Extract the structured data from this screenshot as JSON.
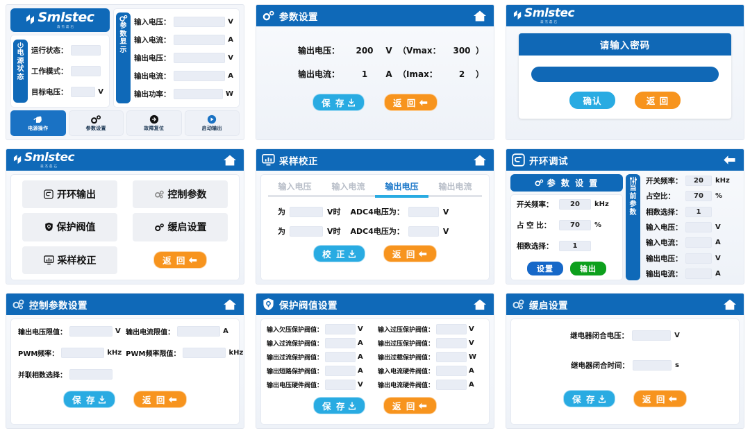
{
  "brand": {
    "name": "Smlstec",
    "sub": "森杰磊石"
  },
  "panel1": {
    "power_tab": "电源状态",
    "power_rows": [
      {
        "label": "运行状态：",
        "value": "",
        "unit": ""
      },
      {
        "label": "工作模式：",
        "value": "",
        "unit": ""
      },
      {
        "label": "目标电压：",
        "value": "",
        "unit": "V"
      }
    ],
    "param_tab": "参数显示",
    "param_rows": [
      {
        "label": "输入电压：",
        "value": "",
        "unit": "V"
      },
      {
        "label": "输入电流：",
        "value": "",
        "unit": "A"
      },
      {
        "label": "输出电压：",
        "value": "",
        "unit": "V"
      },
      {
        "label": "输出电流：",
        "value": "",
        "unit": "A"
      },
      {
        "label": "输出功率：",
        "value": "",
        "unit": "W"
      }
    ],
    "tabs": [
      {
        "label": "电源操作",
        "icon": "hand-pointer-icon",
        "active": true
      },
      {
        "label": "参数设置",
        "icon": "gear-icon",
        "active": false
      },
      {
        "label": "故障复位",
        "icon": "reset-arrow-icon",
        "active": false
      },
      {
        "label": "启动输出",
        "icon": "play-icon",
        "active": false
      }
    ]
  },
  "panel2": {
    "title": "参数设置",
    "title_icon": "gear-icon",
    "home_icon": "home-icon",
    "rows": [
      {
        "label": "输出电压：",
        "value": "200",
        "unit": "V",
        "limit_label": "（Vmax：",
        "limit_value": "300",
        "limit_close": "）"
      },
      {
        "label": "输出电流：",
        "value": "1",
        "unit": "A",
        "limit_label": "（Imax：",
        "limit_value": "2",
        "limit_close": "）"
      }
    ],
    "save": "保 存",
    "back": "返 回"
  },
  "panel3": {
    "dialog_title": "请输入密码",
    "password_value": "",
    "confirm": "确认",
    "back": "返 回"
  },
  "panel4": {
    "home_icon": "home-icon",
    "items": [
      {
        "label": "开环输出",
        "icon": "loop-output-icon"
      },
      {
        "label": "控制参数",
        "icon": "control-params-icon"
      },
      {
        "label": "保护阀值",
        "icon": "shield-icon"
      },
      {
        "label": "缓启设置",
        "icon": "gear-icon"
      },
      {
        "label": "采样校正",
        "icon": "monitor-icon"
      }
    ],
    "back": "返 回"
  },
  "panel5": {
    "title": "采样校正",
    "title_icon": "monitor-icon",
    "home_icon": "home-icon",
    "tabs": [
      {
        "label": "输入电压",
        "active": false
      },
      {
        "label": "输入电流",
        "active": false
      },
      {
        "label": "输出电压",
        "active": true
      },
      {
        "label": "输出电流",
        "active": false
      }
    ],
    "rows": [
      {
        "prefix": "为",
        "value": "",
        "mid": "V时",
        "label": "ADC4电压为：",
        "value2": "",
        "unit": "V"
      },
      {
        "prefix": "为",
        "value": "",
        "mid": "V时",
        "label": "ADC4电压为：",
        "value2": "",
        "unit": "V"
      }
    ],
    "calibrate": "校 正",
    "back": "返 回"
  },
  "panel6": {
    "title": "开环调试",
    "title_icon": "loop-output-icon",
    "back_icon": "back-arrow-icon",
    "section_title": "参 数 设 置",
    "section_icon": "gear-icon",
    "settings": [
      {
        "label": "开关频率：",
        "value": "20",
        "unit": "kHz"
      },
      {
        "label": "占 空 比：",
        "value": "70",
        "unit": "%"
      },
      {
        "label": "相数选择：",
        "value": "1",
        "unit": ""
      }
    ],
    "set_button": "设置",
    "output_button": "输出",
    "current_tab": "当前参数",
    "current_icon": "sliders-icon",
    "current": [
      {
        "label": "开关频率：",
        "value": "20",
        "unit": "kHz"
      },
      {
        "label": "占空比：",
        "value": "70",
        "unit": "%"
      },
      {
        "label": "相数选择：",
        "value": "1",
        "unit": ""
      },
      {
        "label": "输入电压：",
        "value": "",
        "unit": "V"
      },
      {
        "label": "输入电流：",
        "value": "",
        "unit": "A"
      },
      {
        "label": "输出电压：",
        "value": "",
        "unit": "V"
      },
      {
        "label": "输出电流：",
        "value": "",
        "unit": "A"
      }
    ]
  },
  "panel7": {
    "title": "控制参数设置",
    "title_icon": "control-params-icon",
    "home_icon": "home-icon",
    "rows": [
      {
        "label": "输出电压限值：",
        "value": "",
        "unit": "V"
      },
      {
        "label": "输出电流限值：",
        "value": "",
        "unit": "A"
      },
      {
        "label": "PWM频率：",
        "value": "",
        "unit": "kHz"
      },
      {
        "label": "PWM频率限值：",
        "value": "",
        "unit": "kHz"
      },
      {
        "label": "并联相数选择：",
        "value": "",
        "unit": ""
      }
    ],
    "save": "保 存",
    "back": "返 回"
  },
  "panel8": {
    "title": "保护阀值设置",
    "title_icon": "shield-icon",
    "home_icon": "home-icon",
    "rows": [
      {
        "label": "输入欠压保护阀值：",
        "value": "",
        "unit": "V"
      },
      {
        "label": "输入过压保护阀值：",
        "value": "",
        "unit": "V"
      },
      {
        "label": "输入过流保护阀值：",
        "value": "",
        "unit": "A"
      },
      {
        "label": "输出过压保护阀值：",
        "value": "",
        "unit": "V"
      },
      {
        "label": "输出过流保护阀值：",
        "value": "",
        "unit": "A"
      },
      {
        "label": "输出过载保护阀值：",
        "value": "",
        "unit": "W"
      },
      {
        "label": "输出短路保护阀值：",
        "value": "",
        "unit": "A"
      },
      {
        "label": "输入电流硬件阀值：",
        "value": "",
        "unit": "A"
      },
      {
        "label": "输出电压硬件阀值：",
        "value": "",
        "unit": "V"
      },
      {
        "label": "输出电流硬件阀值：",
        "value": "",
        "unit": "A"
      }
    ],
    "save": "保 存",
    "back": "返 回"
  },
  "panel9": {
    "title": "缓启设置",
    "title_icon": "control-params-icon",
    "home_icon": "home-icon",
    "rows": [
      {
        "label": "继电器闭合电压：",
        "value": "",
        "unit": "V"
      },
      {
        "label": "继电器闭合时间：",
        "value": "",
        "unit": "s"
      }
    ],
    "save": "保 存",
    "back": "返 回"
  },
  "colors": {
    "header_blue": "#0f69b8",
    "save_blue": "#29abe2",
    "back_orange": "#f7941e",
    "set_blue": "#1668c8",
    "output_green": "#0da01d",
    "field_bg": "#e9edf5"
  }
}
